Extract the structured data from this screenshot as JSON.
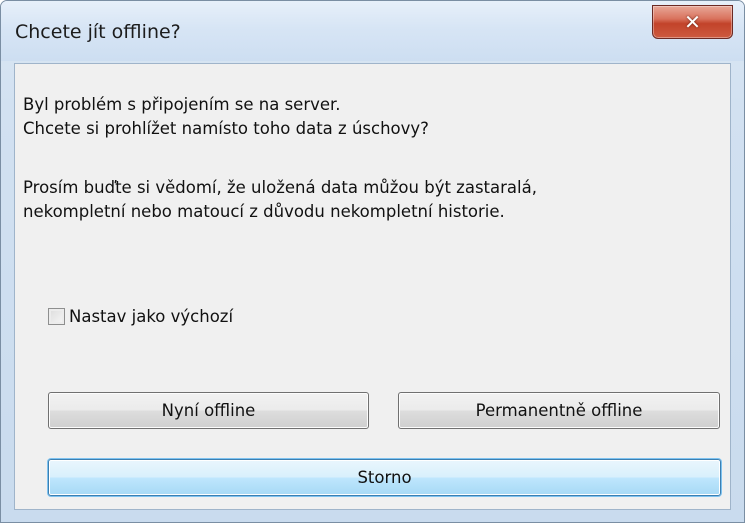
{
  "window": {
    "title": "Chcete jít offline?",
    "close_glyph": "✕"
  },
  "message": {
    "line1": "Byl problém s připojením se na server.",
    "line2": "Chcete si prohlížet namísto toho data z úschovy?",
    "line3": "Prosím buďte si vědomí, že uložená data můžou být zastaralá,",
    "line4": "nekompletní nebo matoucí z důvodu nekompletní historie."
  },
  "checkbox": {
    "label": "Nastav jako výchozí",
    "checked": false
  },
  "buttons": {
    "now_offline": "Nyní offline",
    "permanent_offline": "Permanentně offline",
    "cancel": "Storno"
  },
  "colors": {
    "close_button": "#c2432a",
    "default_button": "#bee6fd",
    "titlebar": "#d7e5f5"
  }
}
